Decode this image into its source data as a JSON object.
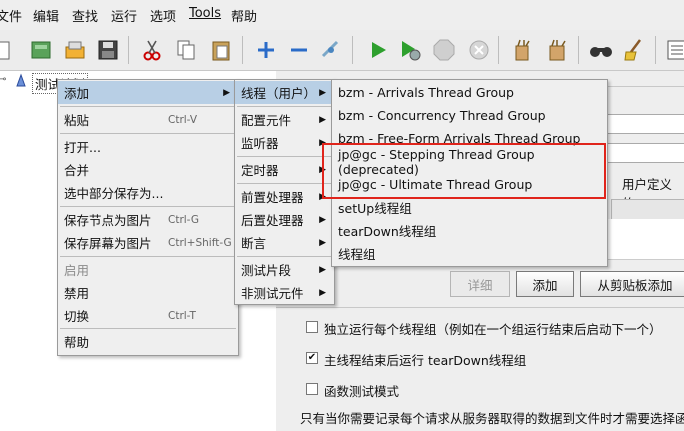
{
  "menubar": [
    "文件",
    "编辑",
    "查找",
    "运行",
    "选项",
    "Tools",
    "帮助"
  ],
  "tree": {
    "root_label": "测试计划"
  },
  "context_menu": {
    "items": [
      {
        "label": "添加",
        "arrow": "▶"
      },
      {
        "label": "粘贴",
        "accel": "Ctrl-V"
      },
      {
        "label": "打开..."
      },
      {
        "label": "合并"
      },
      {
        "label": "选中部分保存为..."
      },
      {
        "label": "保存节点为图片",
        "accel": "Ctrl-G"
      },
      {
        "label": "保存屏幕为图片",
        "accel": "Ctrl+Shift-G"
      },
      {
        "label": "启用"
      },
      {
        "label": "禁用"
      },
      {
        "label": "切换",
        "accel": "Ctrl-T"
      },
      {
        "label": "帮助"
      }
    ]
  },
  "add_submenu": {
    "items": [
      {
        "label": "线程（用户）",
        "arrow": "▶"
      },
      {
        "label": "配置元件",
        "arrow": "▶"
      },
      {
        "label": "监听器",
        "arrow": "▶"
      },
      {
        "label": "定时器",
        "arrow": "▶"
      },
      {
        "label": "前置处理器",
        "arrow": "▶"
      },
      {
        "label": "后置处理器",
        "arrow": "▶"
      },
      {
        "label": "断言",
        "arrow": "▶"
      },
      {
        "label": "测试片段",
        "arrow": "▶"
      },
      {
        "label": "非测试元件",
        "arrow": "▶"
      }
    ]
  },
  "threads_submenu": {
    "items": [
      {
        "label": "bzm - Arrivals Thread Group"
      },
      {
        "label": "bzm - Concurrency Thread Group"
      },
      {
        "label": "bzm - Free-Form Arrivals Thread Group"
      },
      {
        "label": "jp@gc - Stepping Thread Group (deprecated)"
      },
      {
        "label": "jp@gc - Ultimate Thread Group"
      },
      {
        "label": "setUp线程组"
      },
      {
        "label": "tearDown线程组"
      },
      {
        "label": "线程组"
      }
    ],
    "highlight_color": "#e0241b"
  },
  "right_panel": {
    "user_vars_label": "用户定义的",
    "buttons": {
      "detail": "详细",
      "add": "添加",
      "paste": "从剪贴板添加"
    },
    "checkboxes": [
      {
        "label": "独立运行每个线程组（例如在一个组运行结束后启动下一个）",
        "checked": ""
      },
      {
        "label": "主线程结束后运行 tearDown线程组",
        "checked": "✔"
      },
      {
        "label": "函数测试模式",
        "checked": ""
      }
    ],
    "footer_text": "只有当你需要记录每个请求从服务器取得的数据到文件时才需要选择函数"
  }
}
